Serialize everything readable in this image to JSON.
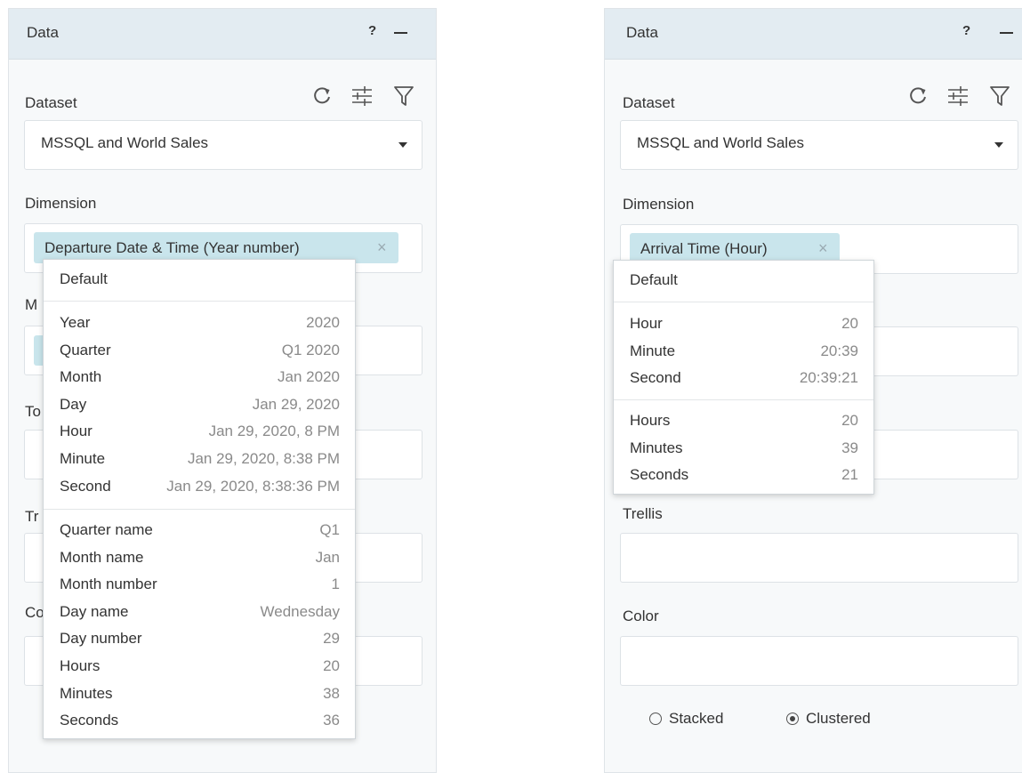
{
  "left": {
    "title": "Data",
    "help": "?",
    "dataset_label": "Dataset",
    "dataset_value": "MSSQL and World Sales",
    "dimension_label": "Dimension",
    "chip_label": "Departure Date & Time (Year number)",
    "chip_close": "×",
    "partial_labels": [
      "M",
      "To",
      "Tr",
      "Co"
    ],
    "dropdown": {
      "default": "Default",
      "group1": [
        {
          "name": "Year",
          "value": "2020"
        },
        {
          "name": "Quarter",
          "value": "Q1 2020"
        },
        {
          "name": "Month",
          "value": "Jan 2020"
        },
        {
          "name": "Day",
          "value": "Jan 29, 2020"
        },
        {
          "name": "Hour",
          "value": "Jan 29, 2020, 8 PM"
        },
        {
          "name": "Minute",
          "value": "Jan 29, 2020, 8:38 PM"
        },
        {
          "name": "Second",
          "value": "Jan 29, 2020, 8:38:36 PM"
        }
      ],
      "group2": [
        {
          "name": "Quarter name",
          "value": "Q1"
        },
        {
          "name": "Month name",
          "value": "Jan"
        },
        {
          "name": "Month number",
          "value": "1"
        },
        {
          "name": "Day name",
          "value": "Wednesday"
        },
        {
          "name": "Day number",
          "value": "29"
        },
        {
          "name": "Hours",
          "value": "20"
        },
        {
          "name": "Minutes",
          "value": "38"
        },
        {
          "name": "Seconds",
          "value": "36"
        }
      ]
    }
  },
  "right": {
    "title": "Data",
    "help": "?",
    "dataset_label": "Dataset",
    "dataset_value": "MSSQL and World Sales",
    "dimension_label": "Dimension",
    "chip_label": "Arrival Time (Hour)",
    "chip_close": "×",
    "trellis_label": "Trellis",
    "color_label": "Color",
    "radio_stacked": "Stacked",
    "radio_clustered": "Clustered",
    "radio_selected": "clustered",
    "dropdown": {
      "default": "Default",
      "group1": [
        {
          "name": "Hour",
          "value": "20"
        },
        {
          "name": "Minute",
          "value": "20:39"
        },
        {
          "name": "Second",
          "value": "20:39:21"
        }
      ],
      "group2": [
        {
          "name": "Hours",
          "value": "20"
        },
        {
          "name": "Minutes",
          "value": "39"
        },
        {
          "name": "Seconds",
          "value": "21"
        }
      ]
    }
  },
  "icons": [
    "refresh-icon",
    "settings-sliders-icon",
    "filter-icon",
    "chevron-down-icon",
    "close-icon"
  ],
  "colors": {
    "panel_bg": "#f7f9fa",
    "header_bg": "#e3ecf2",
    "chip_bg": "#c9e5ec",
    "text": "#333333",
    "muted_value": "#8a8a8a"
  }
}
